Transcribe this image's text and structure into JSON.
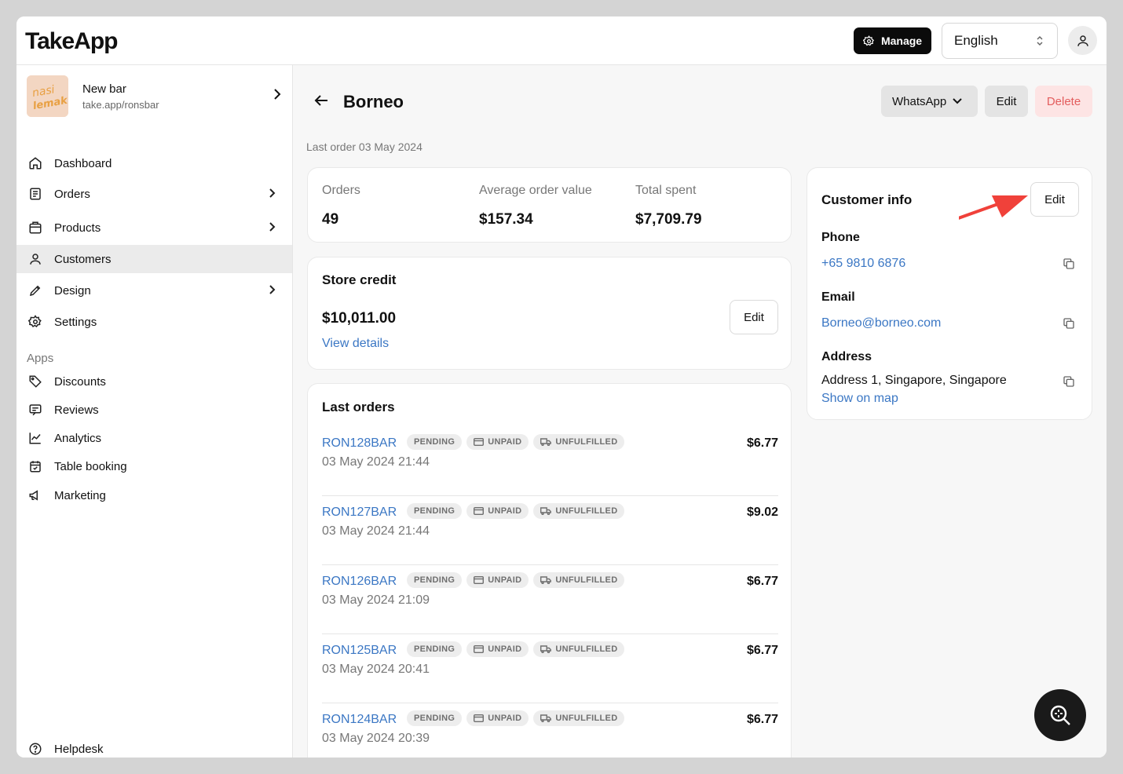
{
  "app": {
    "logo": "TakeApp"
  },
  "topbar": {
    "manage_label": "Manage",
    "language": "English"
  },
  "store": {
    "name": "New bar",
    "url": "take.app/ronsbar",
    "thumb_text": "nasi lemak"
  },
  "sidebar": {
    "items": [
      {
        "label": "Dashboard",
        "icon": "home-icon"
      },
      {
        "label": "Orders",
        "icon": "orders-icon"
      },
      {
        "label": "Products",
        "icon": "products-icon"
      },
      {
        "label": "Customers",
        "icon": "user-icon"
      },
      {
        "label": "Design",
        "icon": "pen-icon"
      },
      {
        "label": "Settings",
        "icon": "gear-icon"
      }
    ],
    "apps_label": "Apps",
    "apps": [
      {
        "label": "Discounts",
        "icon": "tag-icon"
      },
      {
        "label": "Reviews",
        "icon": "review-icon"
      },
      {
        "label": "Analytics",
        "icon": "chart-icon"
      },
      {
        "label": "Table booking",
        "icon": "calendar-icon"
      },
      {
        "label": "Marketing",
        "icon": "megaphone-icon"
      }
    ],
    "helpdesk": "Helpdesk"
  },
  "customer": {
    "name": "Borneo",
    "last_order": "Last order 03 May 2024",
    "actions": {
      "whatsapp": "WhatsApp",
      "edit": "Edit",
      "delete": "Delete"
    }
  },
  "stats": [
    {
      "label": "Orders",
      "value": "49"
    },
    {
      "label": "Average order value",
      "value": "$157.34"
    },
    {
      "label": "Total spent",
      "value": "$7,709.79"
    }
  ],
  "store_credit": {
    "title": "Store credit",
    "amount": "$10,011.00",
    "link": "View details",
    "edit": "Edit"
  },
  "last_orders": {
    "title": "Last orders",
    "badges": {
      "status": "PENDING",
      "payment": "UNPAID",
      "fulfillment": "UNFULFILLED"
    },
    "rows": [
      {
        "id": "RON128BAR",
        "date": "03 May 2024 21:44",
        "amount": "$6.77"
      },
      {
        "id": "RON127BAR",
        "date": "03 May 2024 21:44",
        "amount": "$9.02"
      },
      {
        "id": "RON126BAR",
        "date": "03 May 2024 21:09",
        "amount": "$6.77"
      },
      {
        "id": "RON125BAR",
        "date": "03 May 2024 20:41",
        "amount": "$6.77"
      },
      {
        "id": "RON124BAR",
        "date": "03 May 2024 20:39",
        "amount": "$6.77"
      }
    ]
  },
  "customer_info": {
    "title": "Customer info",
    "edit": "Edit",
    "phone_label": "Phone",
    "phone": "+65 9810 6876",
    "email_label": "Email",
    "email": "Borneo@borneo.com",
    "address_label": "Address",
    "address": "Address 1, Singapore, Singapore",
    "map_link": "Show on map"
  },
  "colors": {
    "link": "#3b77c4",
    "delete": "#e35d5d",
    "annotation": "#f0413a"
  }
}
